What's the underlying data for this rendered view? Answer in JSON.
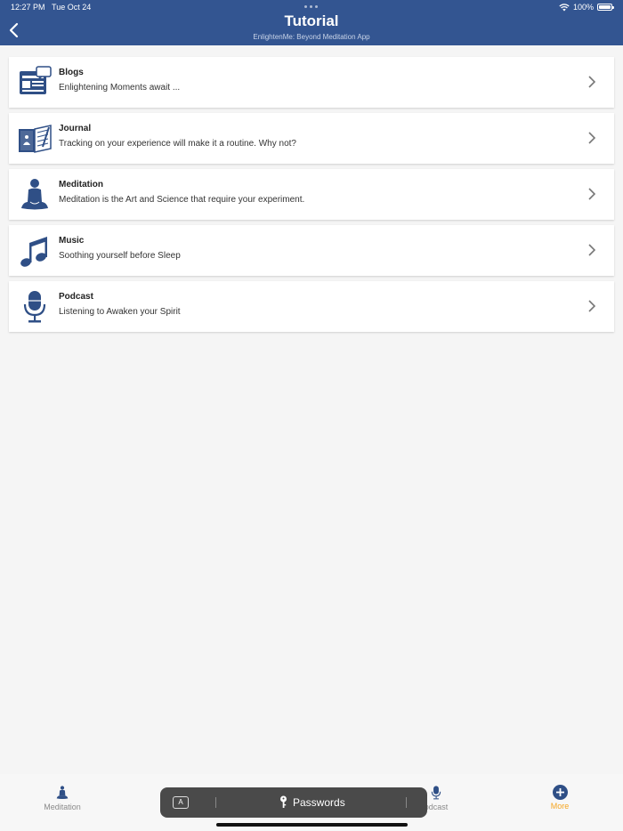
{
  "status": {
    "time": "12:27 PM",
    "date": "Tue Oct 24",
    "battery": "100%"
  },
  "header": {
    "title": "Tutorial",
    "subtitle": "EnlightenMe: Beyond Meditation App"
  },
  "items": [
    {
      "name": "Blogs",
      "desc": "Enlightening Moments await ...",
      "icon": "blog-icon"
    },
    {
      "name": "Journal",
      "desc": "Tracking on your experience will make it a routine. Why not?",
      "icon": "journal-icon"
    },
    {
      "name": "Meditation",
      "desc": "Meditation is the Art and Science that require your experiment.",
      "icon": "meditation-icon"
    },
    {
      "name": "Music",
      "desc": "Soothing yourself before Sleep",
      "icon": "music-icon"
    },
    {
      "name": "Podcast",
      "desc": "Listening to Awaken your Spirit",
      "icon": "podcast-icon"
    }
  ],
  "tabs": [
    {
      "label": "Meditation",
      "icon": "meditation-icon"
    },
    {
      "label": "odcast",
      "icon": "microphone-icon"
    },
    {
      "label": "More",
      "icon": "plus-circle-icon",
      "active": true
    }
  ],
  "keyboard_bar": {
    "key_label": "A",
    "passwords_label": "Passwords"
  },
  "colors": {
    "primary": "#335591",
    "accent": "#f5a623",
    "background": "#f5f5f5"
  }
}
